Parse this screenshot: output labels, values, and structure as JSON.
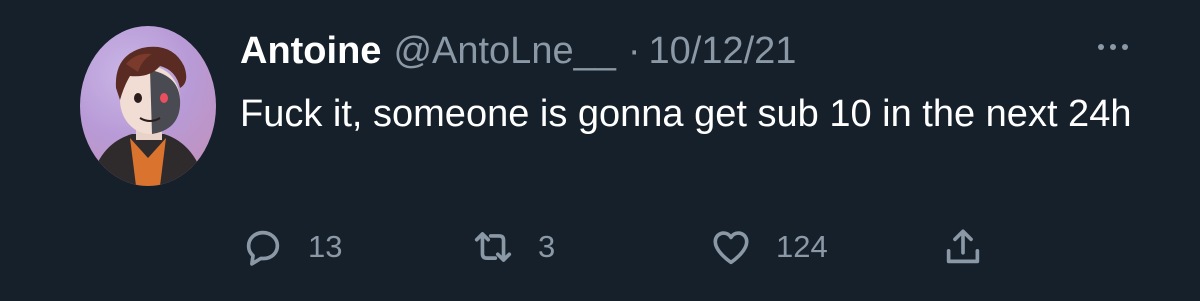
{
  "tweet": {
    "display_name": "Antoine",
    "handle": "@AntoLne__",
    "separator": "·",
    "date": "10/12/21",
    "text": "Fuck it, someone is gonna get sub 10 in the next 24h",
    "more_icon": "more-horizontal-icon",
    "avatar_icon": "avatar-illustration"
  },
  "actions": {
    "reply": {
      "icon": "reply-icon",
      "count": "13"
    },
    "retweet": {
      "icon": "retweet-icon",
      "count": "3"
    },
    "like": {
      "icon": "heart-icon",
      "count": "124"
    },
    "share": {
      "icon": "share-icon"
    }
  },
  "colors": {
    "background": "#15202b",
    "text_primary": "#ffffff",
    "text_secondary": "#8b98a5"
  }
}
